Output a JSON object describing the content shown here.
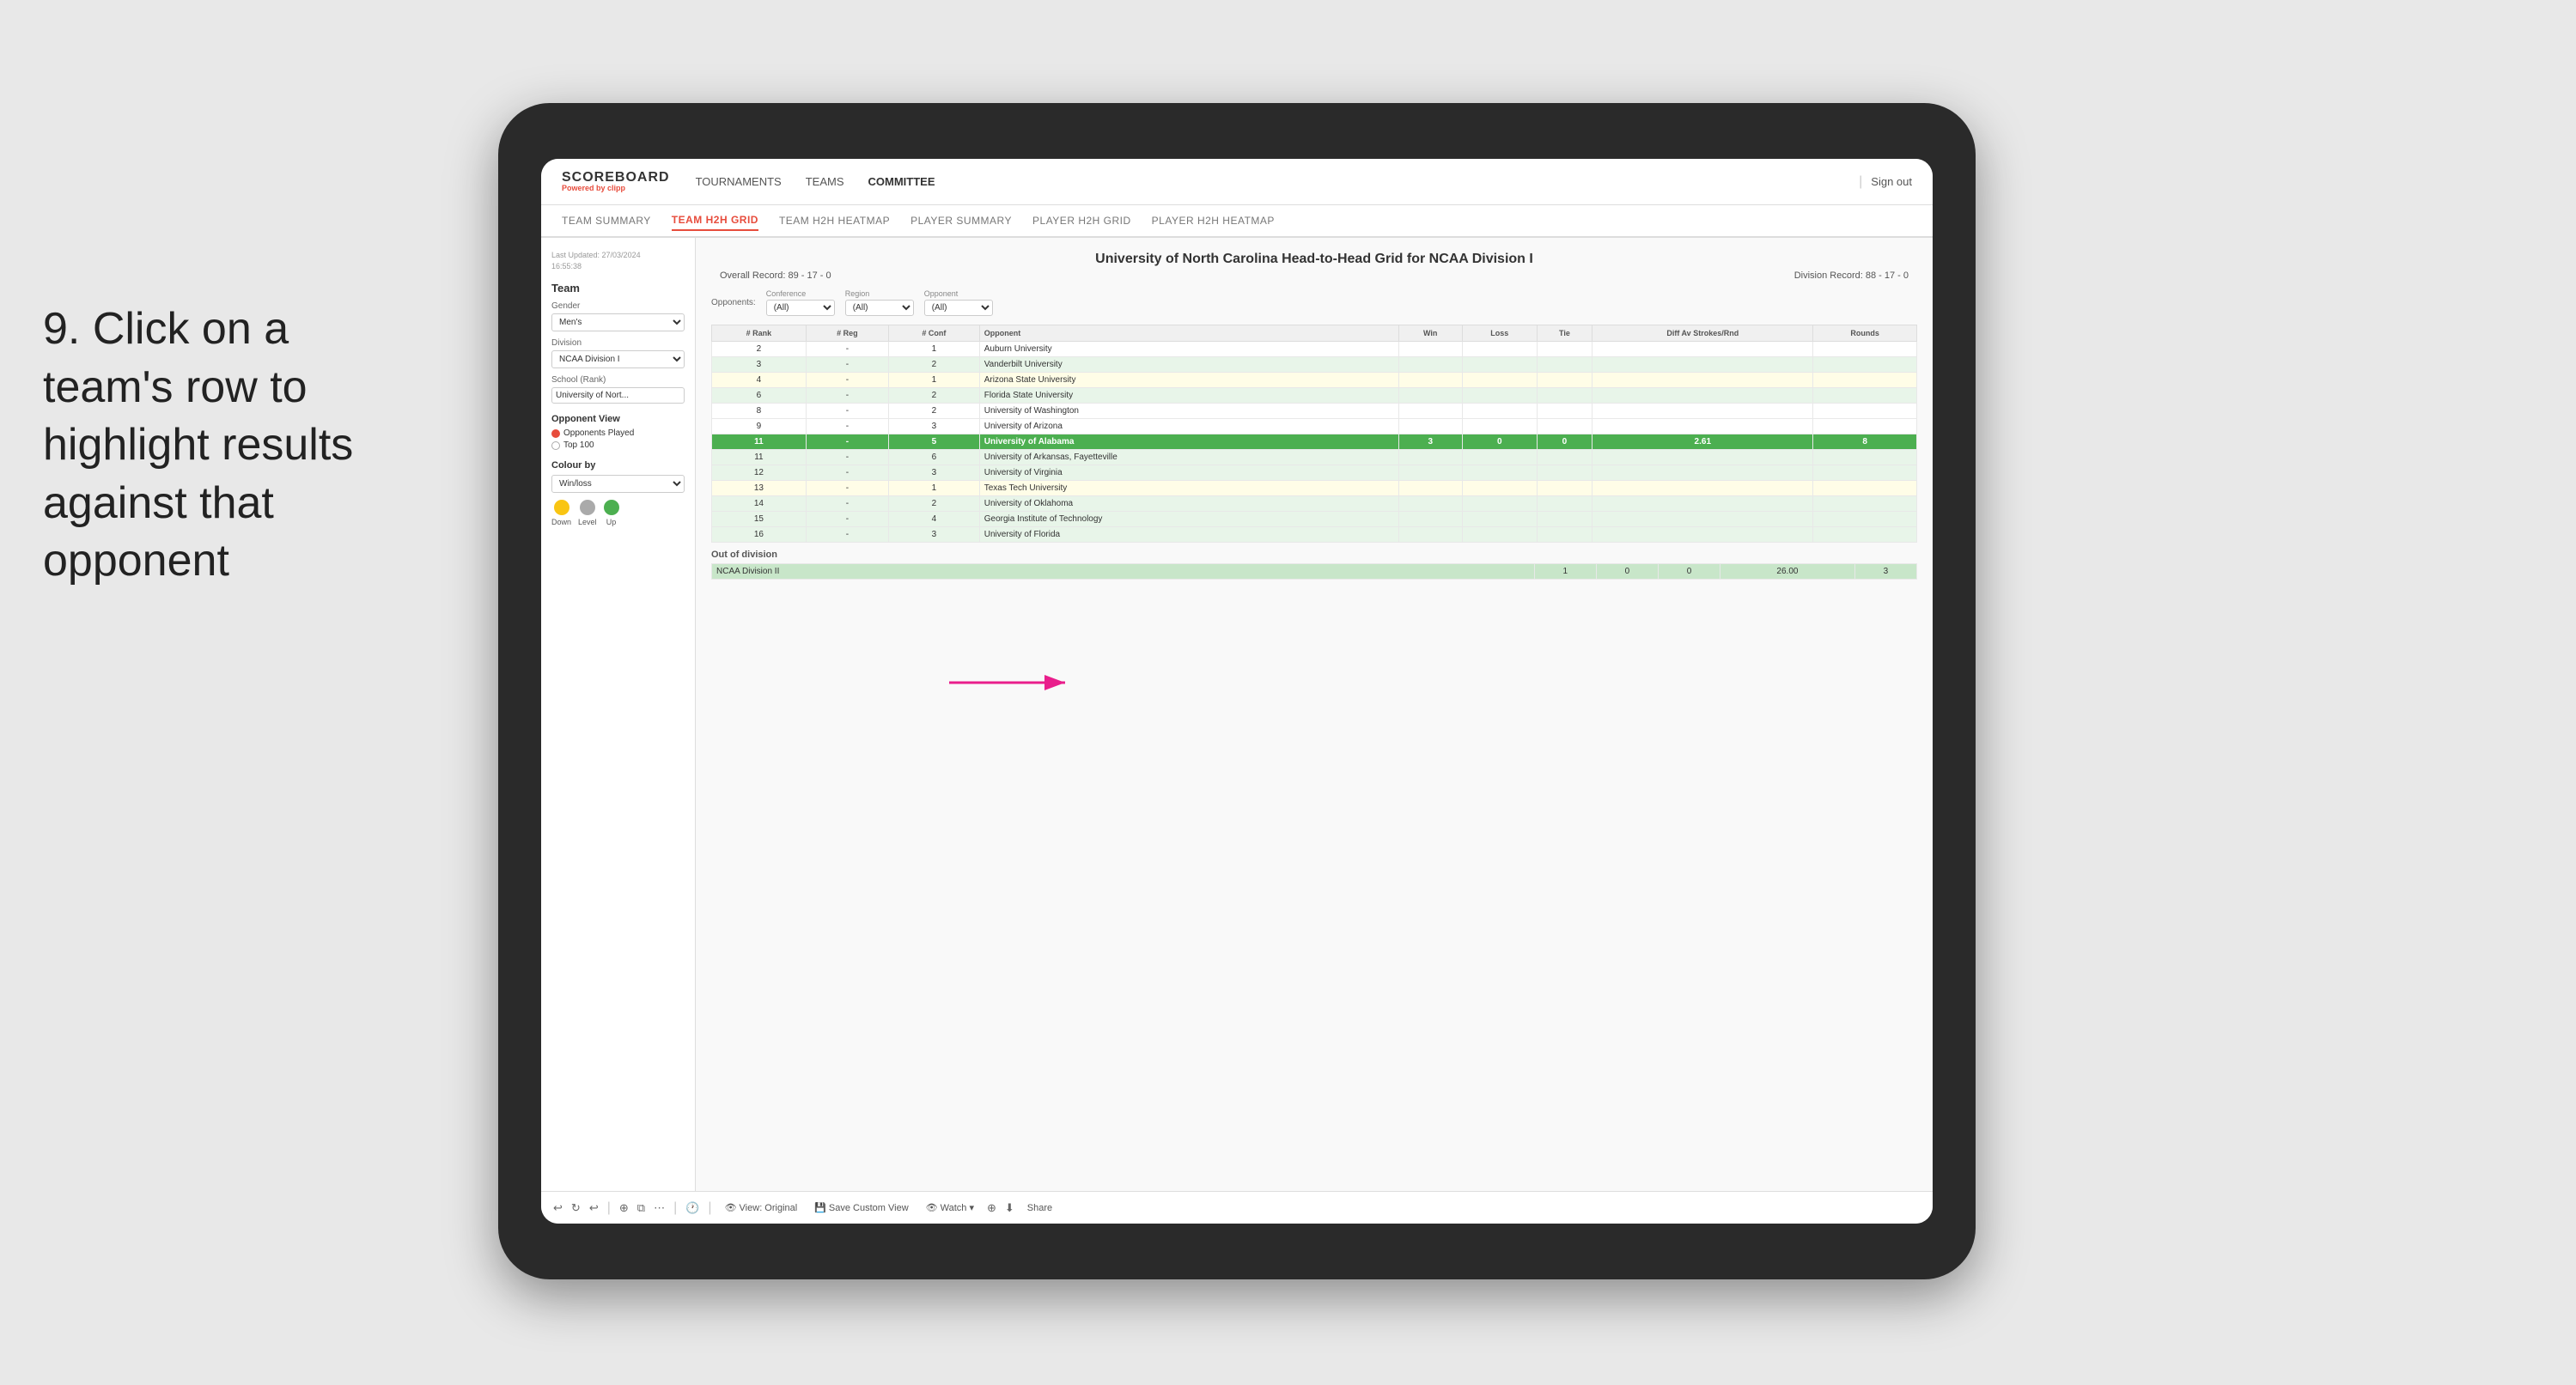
{
  "instruction": {
    "step": "9.",
    "text": "Click on a team's row to highlight results against that opponent"
  },
  "nav": {
    "logo": "SCOREBOARD",
    "logo_sub": "Powered by",
    "logo_brand": "clipp",
    "items": [
      "TOURNAMENTS",
      "TEAMS",
      "COMMITTEE"
    ],
    "sign_out": "Sign out"
  },
  "sub_nav": {
    "items": [
      "TEAM SUMMARY",
      "TEAM H2H GRID",
      "TEAM H2H HEATMAP",
      "PLAYER SUMMARY",
      "PLAYER H2H GRID",
      "PLAYER H2H HEATMAP"
    ],
    "active": "TEAM H2H GRID"
  },
  "sidebar": {
    "last_updated_label": "Last Updated: 27/03/2024",
    "last_updated_time": "16:55:38",
    "team_label": "Team",
    "gender_label": "Gender",
    "gender_value": "Men's",
    "division_label": "Division",
    "division_value": "NCAA Division I",
    "school_label": "School (Rank)",
    "school_value": "University of Nort...",
    "opponent_view_title": "Opponent View",
    "radio_options": [
      "Opponents Played",
      "Top 100"
    ],
    "radio_selected": "Opponents Played",
    "colour_by_title": "Colour by",
    "colour_by_value": "Win/loss",
    "legend": [
      {
        "label": "Down",
        "color": "#f9c513"
      },
      {
        "label": "Level",
        "color": "#aaa"
      },
      {
        "label": "Up",
        "color": "#4caf50"
      }
    ]
  },
  "grid": {
    "title": "University of North Carolina Head-to-Head Grid for NCAA Division I",
    "overall_record": "89 - 17 - 0",
    "division_record": "88 - 17 - 0",
    "filters": {
      "conference_label": "Conference",
      "conference_value": "(All)",
      "region_label": "Region",
      "region_value": "(All)",
      "opponent_label": "Opponent",
      "opponent_value": "(All)",
      "opponents_label": "Opponents:"
    },
    "table_headers": [
      "# Rank",
      "# Reg",
      "# Conf",
      "Opponent",
      "Win",
      "Loss",
      "Tie",
      "Diff Av Strokes/Rnd",
      "Rounds"
    ],
    "rows": [
      {
        "rank": "2",
        "reg": "-",
        "conf": "1",
        "opponent": "Auburn University",
        "win": "",
        "loss": "",
        "tie": "",
        "diff": "",
        "rounds": "",
        "style": "normal"
      },
      {
        "rank": "3",
        "reg": "-",
        "conf": "2",
        "opponent": "Vanderbilt University",
        "win": "",
        "loss": "",
        "tie": "",
        "diff": "",
        "rounds": "",
        "style": "light-green"
      },
      {
        "rank": "4",
        "reg": "-",
        "conf": "1",
        "opponent": "Arizona State University",
        "win": "",
        "loss": "",
        "tie": "",
        "diff": "",
        "rounds": "",
        "style": "light-yellow"
      },
      {
        "rank": "6",
        "reg": "-",
        "conf": "2",
        "opponent": "Florida State University",
        "win": "",
        "loss": "",
        "tie": "",
        "diff": "",
        "rounds": "",
        "style": "light-green"
      },
      {
        "rank": "8",
        "reg": "-",
        "conf": "2",
        "opponent": "University of Washington",
        "win": "",
        "loss": "",
        "tie": "",
        "diff": "",
        "rounds": "",
        "style": "normal"
      },
      {
        "rank": "9",
        "reg": "-",
        "conf": "3",
        "opponent": "University of Arizona",
        "win": "",
        "loss": "",
        "tie": "",
        "diff": "",
        "rounds": "",
        "style": "normal"
      },
      {
        "rank": "11",
        "reg": "-",
        "conf": "5",
        "opponent": "University of Alabama",
        "win": "3",
        "loss": "0",
        "tie": "0",
        "diff": "2.61",
        "rounds": "8",
        "style": "highlighted"
      },
      {
        "rank": "11",
        "reg": "-",
        "conf": "6",
        "opponent": "University of Arkansas, Fayetteville",
        "win": "",
        "loss": "",
        "tie": "",
        "diff": "",
        "rounds": "",
        "style": "light-green"
      },
      {
        "rank": "12",
        "reg": "-",
        "conf": "3",
        "opponent": "University of Virginia",
        "win": "",
        "loss": "",
        "tie": "",
        "diff": "",
        "rounds": "",
        "style": "light-green"
      },
      {
        "rank": "13",
        "reg": "-",
        "conf": "1",
        "opponent": "Texas Tech University",
        "win": "",
        "loss": "",
        "tie": "",
        "diff": "",
        "rounds": "",
        "style": "light-yellow"
      },
      {
        "rank": "14",
        "reg": "-",
        "conf": "2",
        "opponent": "University of Oklahoma",
        "win": "",
        "loss": "",
        "tie": "",
        "diff": "",
        "rounds": "",
        "style": "light-green"
      },
      {
        "rank": "15",
        "reg": "-",
        "conf": "4",
        "opponent": "Georgia Institute of Technology",
        "win": "",
        "loss": "",
        "tie": "",
        "diff": "",
        "rounds": "",
        "style": "light-green"
      },
      {
        "rank": "16",
        "reg": "-",
        "conf": "3",
        "opponent": "University of Florida",
        "win": "",
        "loss": "",
        "tie": "",
        "diff": "",
        "rounds": "",
        "style": "light-green"
      }
    ],
    "out_of_division_label": "Out of division",
    "out_of_division_rows": [
      {
        "opponent": "NCAA Division II",
        "win": "1",
        "loss": "0",
        "tie": "0",
        "diff": "26.00",
        "rounds": "3",
        "style": "green-bg"
      }
    ]
  },
  "toolbar": {
    "buttons": [
      "View: Original",
      "Save Custom View",
      "Watch ▾",
      "Share"
    ]
  }
}
